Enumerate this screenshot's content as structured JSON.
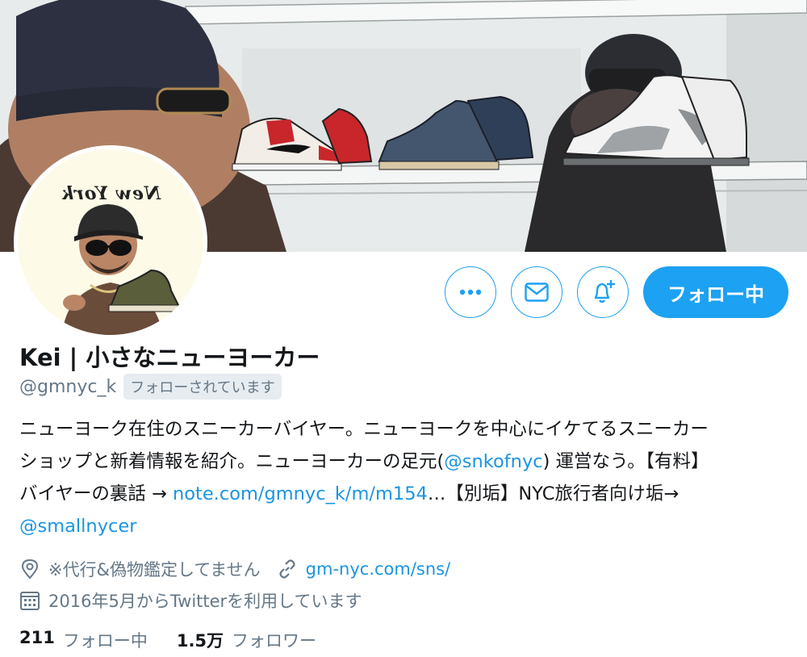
{
  "profile": {
    "display_name": "Kei | 小さなニューヨーカー",
    "handle": "@gmnyc_k",
    "follows_you_badge": "フォローされています",
    "avatar_logo_text": "New York"
  },
  "actions": {
    "more_icon": "more-icon",
    "message_icon": "mail-icon",
    "notify_icon": "bell-plus-icon",
    "follow_label": "フォロー中"
  },
  "bio": {
    "line1": "ニューヨーク在住のスニーカーバイヤー。ニューヨークを中心にイケてるスニーカー",
    "line2_a": "ショップと新着情報を紹介。ニューヨーカーの足元(",
    "line2_link": "@snkofnyc",
    "line2_b": ") 運営なう。【有料】",
    "line3_a": "バイヤーの裏話 → ",
    "line3_link": "note.com/gmnyc_k/m/m154",
    "line3_b": "…【別垢】NYC旅行者向け垢→",
    "line4_link": "@smallnycer"
  },
  "meta": {
    "location": "※代行&偽物鑑定してません",
    "website": "gm-nyc.com/sns/",
    "joined": "2016年5月からTwitterを利用しています"
  },
  "stats": {
    "following_count": "211",
    "following_label": "フォロー中",
    "followers_count": "1.5万",
    "followers_label": "フォロワー"
  },
  "colors": {
    "accent": "#1da1f2",
    "link": "#1b95e0",
    "muted": "#657786"
  }
}
